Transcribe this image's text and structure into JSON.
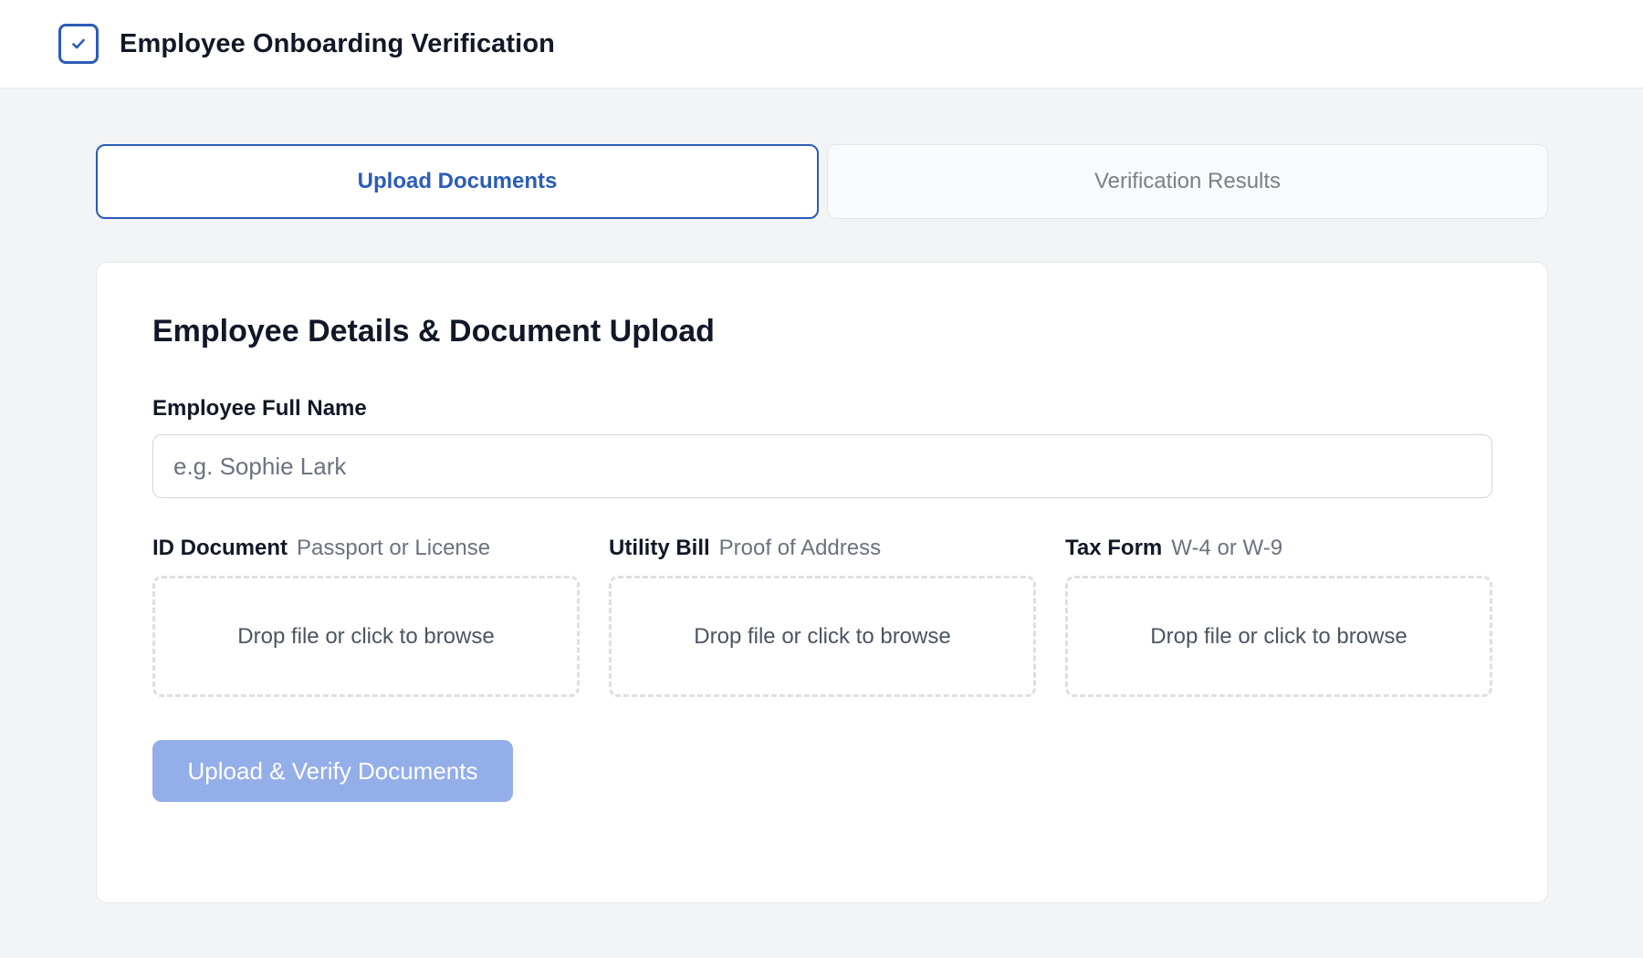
{
  "header": {
    "title": "Employee Onboarding Verification",
    "icon": "checkbox-check-icon",
    "accent_color": "#2b5cb8"
  },
  "tabs": [
    {
      "label": "Upload Documents",
      "active": true
    },
    {
      "label": "Verification Results",
      "active": false
    }
  ],
  "form": {
    "title": "Employee Details & Document Upload",
    "name_field": {
      "label": "Employee Full Name",
      "placeholder": "e.g. Sophie Lark",
      "value": ""
    },
    "uploads": [
      {
        "label": "ID Document",
        "hint": "Passport or License",
        "dropzone_text": "Drop file or click to browse"
      },
      {
        "label": "Utility Bill",
        "hint": "Proof of Address",
        "dropzone_text": "Drop file or click to browse"
      },
      {
        "label": "Tax Form",
        "hint": "W-4 or W-9",
        "dropzone_text": "Drop file or click to browse"
      }
    ],
    "submit_label": "Upload & Verify Documents",
    "submit_color": "#93aee8",
    "submit_disabled": true
  }
}
